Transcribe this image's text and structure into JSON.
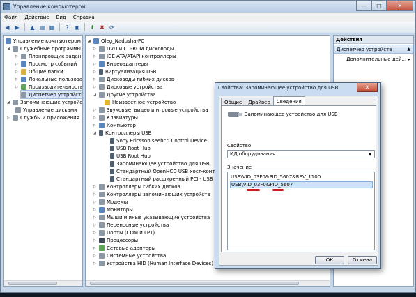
{
  "window": {
    "title": "Управление компьютером",
    "controls": {
      "minimize": "—",
      "maximize": "□",
      "close": "✕"
    }
  },
  "menu": [
    "Файл",
    "Действие",
    "Вид",
    "Справка"
  ],
  "toolbar_icons": [
    "back-icon",
    "forward-icon",
    "up-folder-icon",
    "show-tree-icon",
    "properties-icon",
    "help-icon",
    "view-icon",
    "update-driver-icon",
    "uninstall-icon",
    "scan-hardware-icon"
  ],
  "left_tree": [
    {
      "label": "Управление компьютером (л"
    },
    {
      "label": "Служебные программы"
    },
    {
      "label": "Планировщик задани"
    },
    {
      "label": "Просмотр событий"
    },
    {
      "label": "Общие папки"
    },
    {
      "label": "Локальные пользоват"
    },
    {
      "label": "Производительность"
    },
    {
      "label": "Диспетчер устройств"
    },
    {
      "label": "Запоминающие устройст"
    },
    {
      "label": "Управление дисками"
    },
    {
      "label": "Службы и приложения"
    }
  ],
  "device_tree": [
    {
      "label": "Oleg_Nadusha-PC"
    },
    {
      "label": "DVD и CD-ROM дисководы"
    },
    {
      "label": "IDE ATA/ATAPI контроллеры"
    },
    {
      "label": "Видеоадаптеры"
    },
    {
      "label": "Виртуализация USB"
    },
    {
      "label": "Дисководы гибких дисков"
    },
    {
      "label": "Дисковые устройства"
    },
    {
      "label": "Другие устройства"
    },
    {
      "label": "Неизвестное устройство"
    },
    {
      "label": "Звуковые, видео и игровые устройства"
    },
    {
      "label": "Клавиатуры"
    },
    {
      "label": "Компьютер"
    },
    {
      "label": "Контроллеры USB"
    },
    {
      "label": "Sony Ericsson seehcri Control Device"
    },
    {
      "label": "USB Root Hub"
    },
    {
      "label": "USB Root Hub"
    },
    {
      "label": "Запоминающее устройство для USB"
    },
    {
      "label": "Стандартный OpenHCD USB хост-контролл"
    },
    {
      "label": "Стандартный расширенный PCI - USB хост"
    },
    {
      "label": "Контроллеры гибких дисков"
    },
    {
      "label": "Контроллеры запоминающих устройств"
    },
    {
      "label": "Модемы"
    },
    {
      "label": "Мониторы"
    },
    {
      "label": "Мыши и иные указывающие устройства"
    },
    {
      "label": "Переносные устройства"
    },
    {
      "label": "Порты (COM и LPT)"
    },
    {
      "label": "Процессоры"
    },
    {
      "label": "Сетевые адаптеры"
    },
    {
      "label": "Системные устройства"
    },
    {
      "label": "Устройства HID (Human Interface Devices)"
    }
  ],
  "actions": {
    "header": "Действия",
    "section": "Диспетчер устройств",
    "more": "Дополнительные дей..."
  },
  "dialog": {
    "title": "Свойства: Запоминающее устройство для USB",
    "close": "✕",
    "tabs": [
      "Общие",
      "Драйвер",
      "Сведения"
    ],
    "device_name": "Запоминающее устройство для USB",
    "property_label": "Свойство",
    "property_value": "ИД оборудования",
    "value_label": "Значение",
    "values": [
      "USB\\VID_03F0&PID_5607&REV_1100",
      "USB\\VID_03F0&PID_5607"
    ],
    "ok": "ОК",
    "cancel": "Отмена"
  }
}
